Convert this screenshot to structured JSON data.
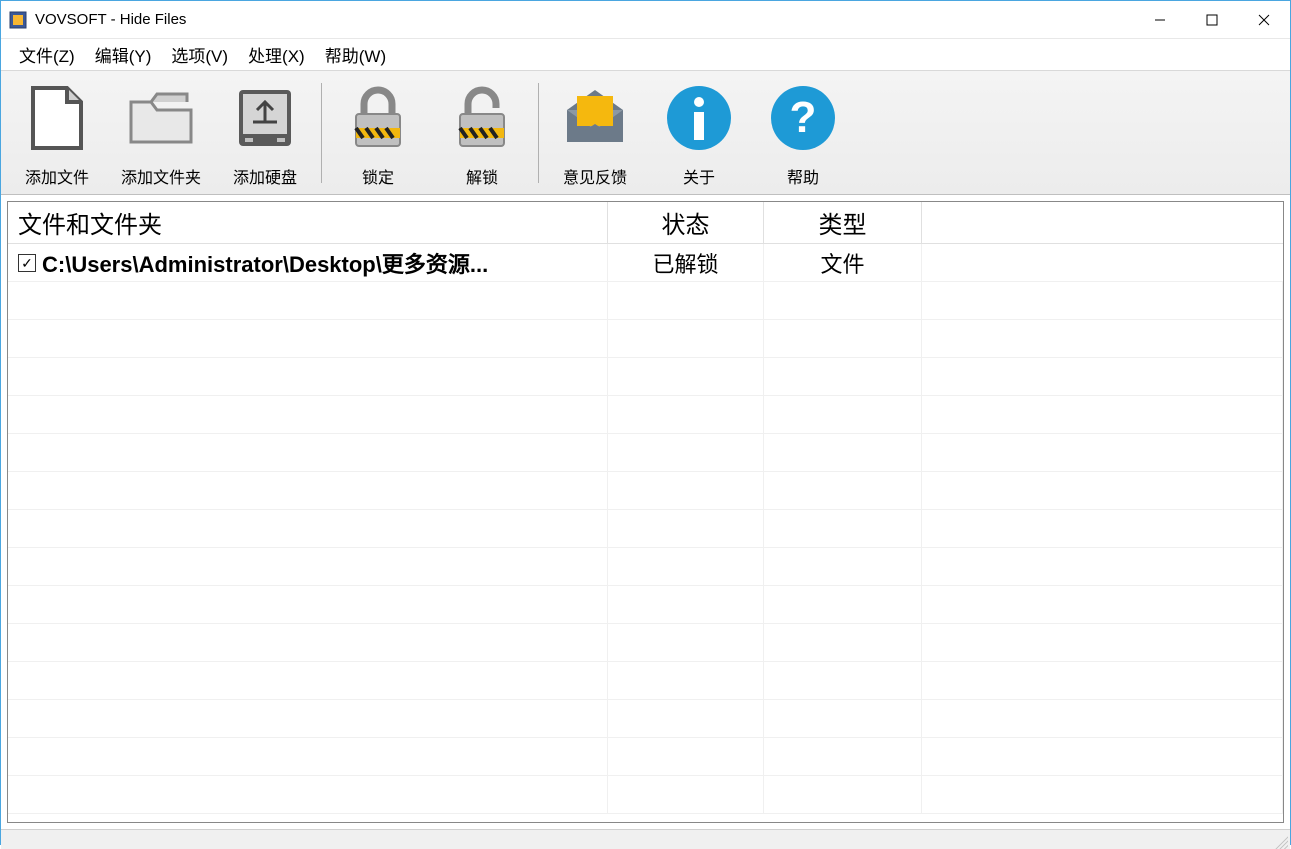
{
  "window": {
    "title": "VOVSOFT - Hide Files"
  },
  "menu": {
    "file": "文件(Z)",
    "edit": "编辑(Y)",
    "options": "选项(V)",
    "process": "处理(X)",
    "help": "帮助(W)"
  },
  "toolbar": {
    "add_file": "添加文件",
    "add_folder": "添加文件夹",
    "add_disk": "添加硬盘",
    "lock": "锁定",
    "unlock": "解锁",
    "feedback": "意见反馈",
    "about": "关于",
    "help": "帮助"
  },
  "columns": {
    "path": "文件和文件夹",
    "status": "状态",
    "type": "类型"
  },
  "rows": [
    {
      "checked": true,
      "path": "C:\\Users\\Administrator\\Desktop\\更多资源...",
      "status": "已解锁",
      "type": "文件"
    }
  ]
}
